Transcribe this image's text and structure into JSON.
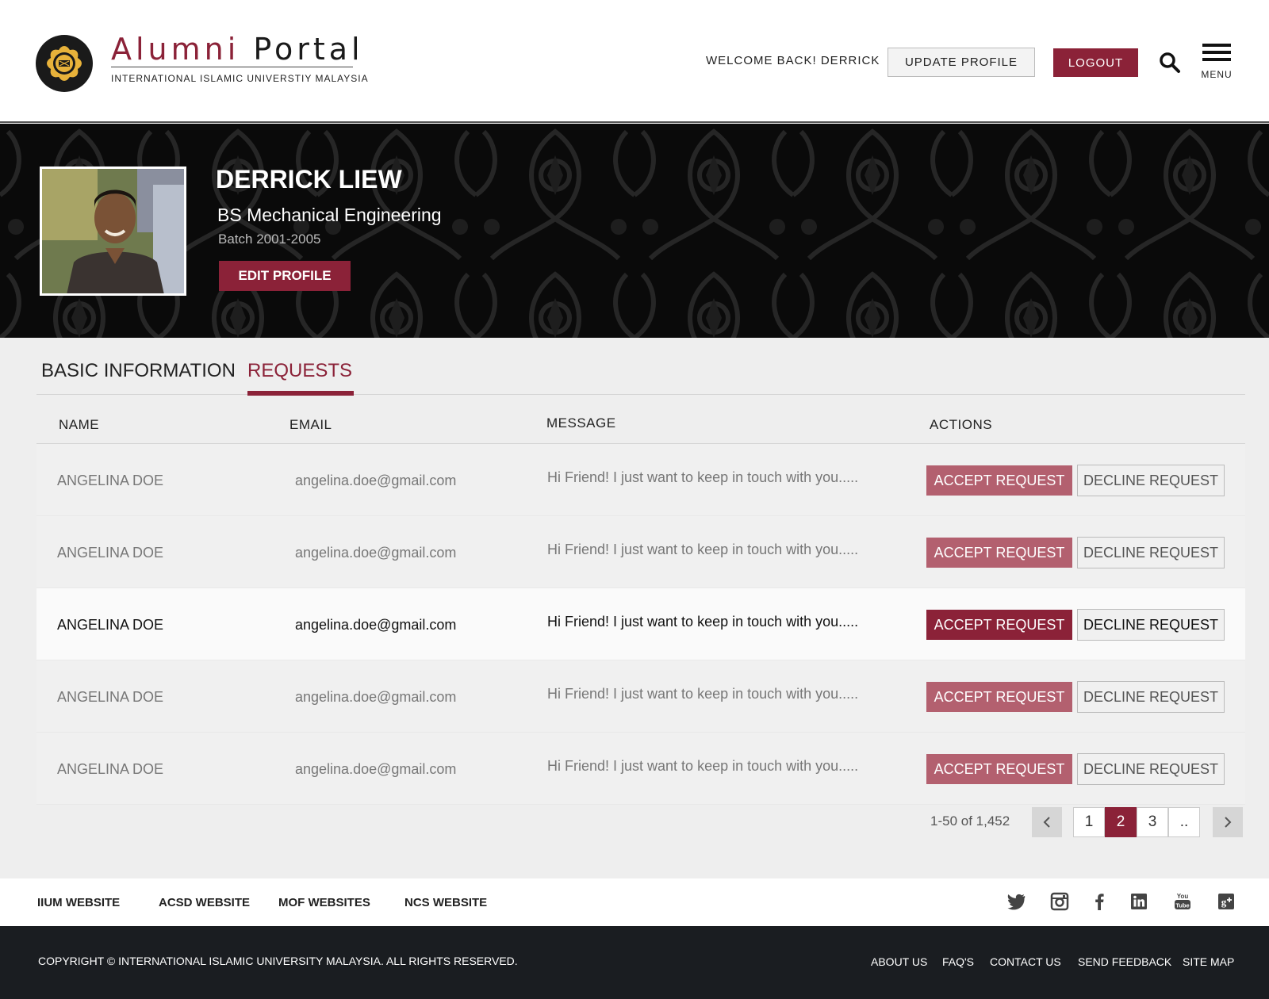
{
  "header": {
    "brand_part1": "Alumni",
    "brand_part2": "Portal",
    "brand_subtitle": "INTERNATIONAL ISLAMIC UNIVERSTIY MALAYSIA",
    "welcome": "WELCOME BACK! DERRICK",
    "update_profile": "UPDATE PROFILE",
    "logout": "LOGOUT",
    "menu": "MENU",
    "accent_color": "#8b2238"
  },
  "profile": {
    "name": "DERRICK LIEW",
    "degree": "BS Mechanical Engineering",
    "batch": "Batch 2001-2005",
    "edit_button": "EDIT PROFILE"
  },
  "tabs": [
    {
      "label": "BASIC INFORMATION",
      "active": false
    },
    {
      "label": "REQUESTS",
      "active": true
    }
  ],
  "table": {
    "columns": [
      "NAME",
      "EMAIL",
      "MESSAGE",
      "ACTIONS"
    ],
    "accept_label": "ACCEPT REQUEST",
    "decline_label": "DECLINE REQUEST",
    "rows": [
      {
        "name": "ANGELINA DOE",
        "email": "angelina.doe@gmail.com",
        "message": "Hi Friend! I just want to keep in touch with you.....",
        "highlighted": false
      },
      {
        "name": "ANGELINA DOE",
        "email": "angelina.doe@gmail.com",
        "message": "Hi Friend! I just want to keep in touch with you.....",
        "highlighted": false
      },
      {
        "name": "ANGELINA DOE",
        "email": "angelina.doe@gmail.com",
        "message": "Hi Friend! I just want to keep in touch with you.....",
        "highlighted": true
      },
      {
        "name": "ANGELINA DOE",
        "email": "angelina.doe@gmail.com",
        "message": "Hi Friend! I just want to keep in touch with you.....",
        "highlighted": false
      },
      {
        "name": "ANGELINA DOE",
        "email": "angelina.doe@gmail.com",
        "message": "Hi Friend! I just want to keep in touch with you.....",
        "highlighted": false
      }
    ]
  },
  "pagination": {
    "info": "1-50 of 1,452",
    "pages": [
      "1",
      "2",
      "3",
      ".."
    ],
    "current": "2",
    "prev_icon": "chevron-left-icon",
    "next_icon": "chevron-right-icon"
  },
  "footer": {
    "links": [
      "IIUM WEBSITE",
      "ACSD WEBSITE",
      "MOF WEBSITES",
      "NCS WEBSITE"
    ],
    "social_icons": [
      "twitter-icon",
      "instagram-icon",
      "facebook-icon",
      "linkedin-icon",
      "youtube-icon",
      "google-plus-icon"
    ],
    "copyright": "COPYRIGHT © INTERNATIONAL ISLAMIC UNIVERSITY MALAYSIA. ALL RIGHTS RESERVED.",
    "bottom_links": [
      "ABOUT US",
      "FAQ'S",
      "CONTACT US",
      "SEND FEEDBACK",
      "SITE MAP"
    ]
  }
}
